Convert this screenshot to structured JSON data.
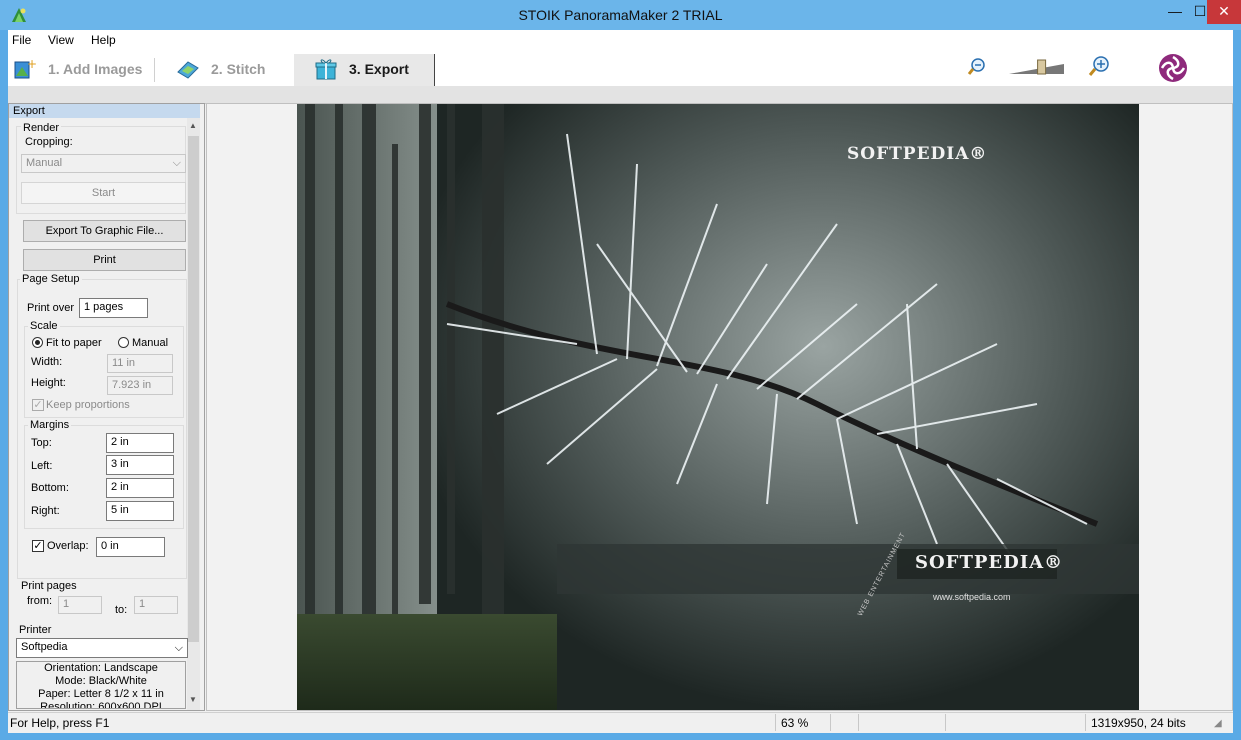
{
  "window": {
    "title": "STOIK PanoramaMaker 2 TRIAL",
    "minimize": "—",
    "maximize": "☐",
    "close": "✕"
  },
  "menu": [
    "File",
    "View",
    "Help"
  ],
  "steps": [
    {
      "label": "1. Add Images",
      "icon": "add-images-icon"
    },
    {
      "label": "2. Stitch",
      "icon": "stitch-icon"
    },
    {
      "label": "3. Export",
      "icon": "export-gift-icon"
    }
  ],
  "toolbar": {
    "zoom_out_icon": "zoom-out-icon",
    "zoom_in_icon": "zoom-in-icon",
    "zoom_level": 0.6,
    "logo_icon": "stoik-logo-icon"
  },
  "panel": {
    "header": "Export",
    "render": {
      "label": "Render",
      "cropping_label": "Cropping:",
      "cropping_value": "Manual",
      "start_label": "Start"
    },
    "export_button": "Export To Graphic File...",
    "print_button": "Print",
    "page_setup": {
      "label": "Page Setup",
      "print_over_label": "Print over",
      "print_over_value": "1 pages",
      "scale_label": "Scale",
      "fit_label": "Fit to paper",
      "manual_label": "Manual",
      "width_label": "Width:",
      "width_value": "11 in",
      "height_label": "Height:",
      "height_value": "7.923 in",
      "keep_label": "Keep proportions"
    },
    "margins": {
      "label": "Margins",
      "top_label": "Top:",
      "top_value": "2 in",
      "left_label": "Left:",
      "left_value": "3 in",
      "bottom_label": "Bottom:",
      "bottom_value": "2 in",
      "right_label": "Right:",
      "right_value": "5 in"
    },
    "overlap_label": "Overlap:",
    "overlap_value": "0 in",
    "print_pages": {
      "label": "Print pages",
      "from_label": "from:",
      "from_value": "1",
      "to_label": "to:",
      "to_value": "1"
    },
    "printer": {
      "label": "Printer",
      "value": "Softpedia",
      "info": [
        "Orientation: Landscape",
        "Mode: Black/White",
        "Paper: Letter 8 1/2 x 11 in",
        "Resolution: 600x600 DPI"
      ]
    }
  },
  "image": {
    "watermark_top": "SOFTPEDIA®",
    "watermark_bottom": "SOFTPEDIA®",
    "url": "www.softpedia.com",
    "web": "WEB ENTERTAINMENT"
  },
  "status": {
    "help": "For Help, press F1",
    "zoom": "63 %",
    "info": "1319x950, 24 bits"
  }
}
